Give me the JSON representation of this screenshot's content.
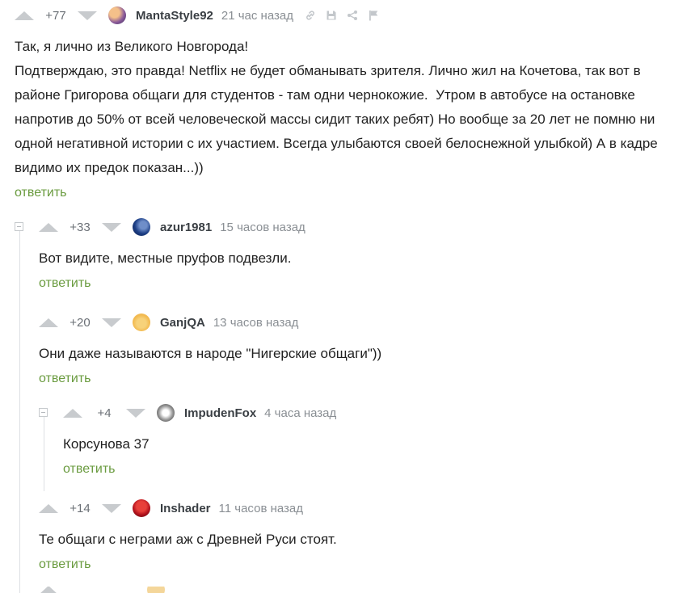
{
  "comments": [
    {
      "rating": "+77",
      "user": "MantaStyle92",
      "time": "21 час назад",
      "text": "Так, я лично из Великого Новгорода!\nПодтверждаю, это правда! Netflix не будет обманывать зрителя. Лично жил на Кочетова, так вот в районе Григорова общаги для студентов - там одни чернокожие.  Утром в автобусе на остановке напротив до 50% от всей человеческой массы сидит таких ребят) Но вообще за 20 лет не помню ни одной негативной истории с их участием. Всегда улыбаются своей белоснежной улыбкой) А в кадре видимо их предок показан...))",
      "reply": "ответить"
    },
    {
      "rating": "+33",
      "user": "azur1981",
      "time": "15 часов назад",
      "text": "Вот видите, местные пруфов подвезли.",
      "reply": "ответить"
    },
    {
      "rating": "+20",
      "user": "GanjQA",
      "time": "13 часов назад",
      "text": "Они даже называются в народе \"Нигерские общаги\"))",
      "reply": "ответить"
    },
    {
      "rating": "+4",
      "user": "ImpudenFox",
      "time": "4 часа назад",
      "text": "Корсунова 37",
      "reply": "ответить"
    },
    {
      "rating": "+14",
      "user": "Inshader",
      "time": "11 часов назад",
      "text": "Те общаги с неграми аж с Древней Руси стоят.",
      "reply": "ответить"
    }
  ],
  "icons": {
    "upvote": "upvote-arrow-icon",
    "downvote": "downvote-arrow-icon",
    "link": "link-icon",
    "save": "save-icon",
    "share": "share-icon",
    "report": "flag-icon",
    "collapse": "collapse-thread-icon"
  },
  "colors": {
    "reply_link": "#6a9b3f",
    "vote_arrow": "#c8cbce",
    "thread_line": "#dde0e3"
  }
}
